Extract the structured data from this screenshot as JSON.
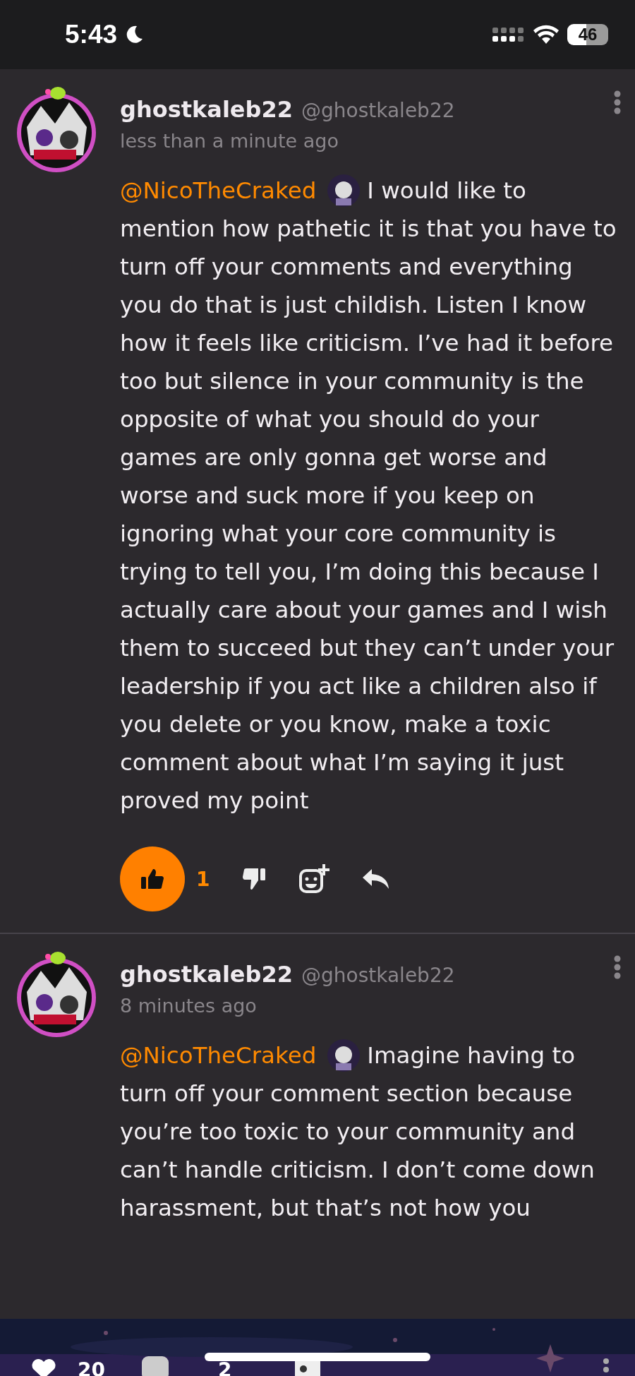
{
  "status_bar": {
    "time": "5:43",
    "battery": "46"
  },
  "comments": [
    {
      "username": "ghostkaleb22",
      "handle": "@ghostkaleb22",
      "time": "less than a minute ago",
      "mention": "@NicoTheCraked",
      "text": "I would like to mention how pathetic it is that you have to turn off your comments and everything you do that is just childish. Listen I know how it feels like criticism. I’ve had it before too but silence in your community is the opposite of what you should do your games are only gonna get worse and worse and suck more if you keep on ignoring what your core community is trying to tell you, I’m doing this because I actually care about your games and I wish them to succeed but they can’t under your leadership if you act like a children also if you delete or you know, make a toxic comment about what I’m saying it just proved my point",
      "liked": true,
      "likes": "1"
    },
    {
      "username": "ghostkaleb22",
      "handle": "@ghostkaleb22",
      "time": "8 minutes ago",
      "mention": "@NicoTheCraked",
      "text": "Imagine having to turn off your comment section because you’re too toxic to your community and can’t handle criticism. I don’t come down harassment, but that’s not how you"
    }
  ],
  "bottom_bar": {
    "likes": "20",
    "comments": "2"
  }
}
